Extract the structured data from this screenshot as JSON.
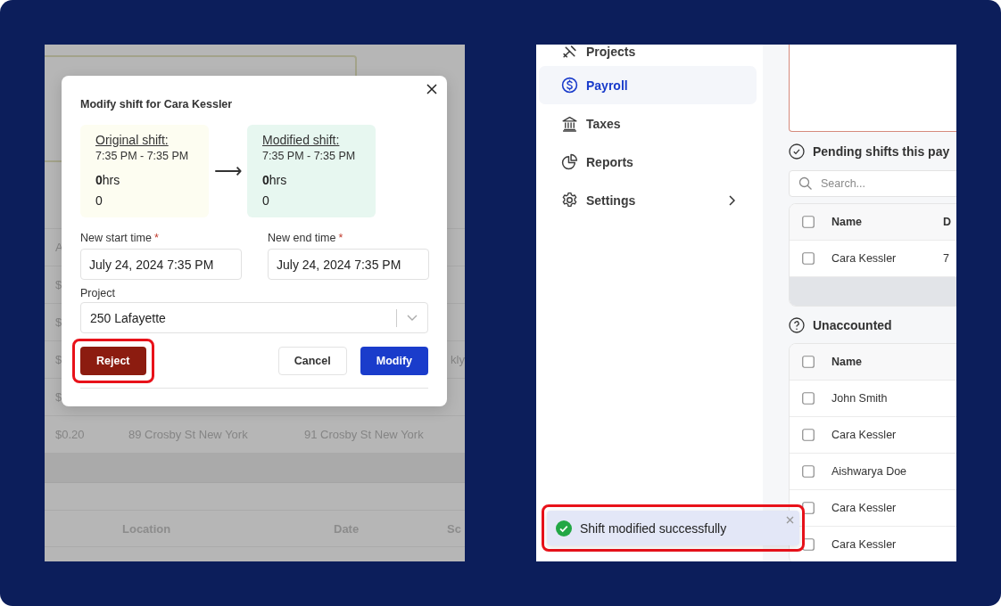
{
  "left_panel": {
    "upper_table": {
      "rows": [
        {
          "column_1": "A"
        },
        {
          "column_1": "$"
        },
        {
          "column_1": "$"
        },
        {
          "column_1": "$",
          "column_4": "kly"
        },
        {
          "column_1": "$"
        },
        {
          "column_1": "$0.20",
          "column_2": "89 Crosby St New York",
          "column_3": "91 Crosby St New York"
        }
      ]
    },
    "lower_table": {
      "header": {
        "column_2": "Location",
        "column_3": "Date",
        "column_4": "Sc"
      }
    },
    "dialog": {
      "title": "Modify shift for Cara Kessler",
      "original": {
        "heading": "Original shift:",
        "time": "7:35 PM - 7:35 PM",
        "hours": "**0**hrs",
        "amount": "0"
      },
      "arrow": "⟶",
      "modified": {
        "heading": "Modified shift:",
        "time": "7:35 PM - 7:35 PM",
        "hours": "**0**hrs",
        "amount": "0"
      },
      "fields": [
        {
          "label": "New start time",
          "required_mark": "*",
          "value": "July 24, 2024 7:35 PM"
        },
        {
          "label": "New end time",
          "required_mark": "*",
          "value": "July 24, 2024 7:35 PM"
        }
      ],
      "project": {
        "label": "Project",
        "value": "250 Lafayette"
      },
      "buttons": [
        {
          "label": "Reject",
          "kind": "danger",
          "highlighted": true
        },
        {
          "label": "Cancel",
          "kind": "secondary",
          "highlighted": false
        },
        {
          "label": "Modify",
          "kind": "primary",
          "highlighted": false
        }
      ]
    }
  },
  "right_panel": {
    "sidebar": {
      "items": [
        {
          "label": "Projects",
          "selected": false,
          "has_submenu": false
        },
        {
          "label": "Payroll",
          "selected": true,
          "has_submenu": false
        },
        {
          "label": "Taxes",
          "selected": false,
          "has_submenu": false
        },
        {
          "label": "Reports",
          "selected": false,
          "has_submenu": false
        },
        {
          "label": "Settings",
          "selected": false,
          "has_submenu": true
        }
      ]
    },
    "pending": {
      "title": "Pending shifts this pay",
      "search": {
        "placeholder": "Search..."
      },
      "table": {
        "header": {
          "checked": false,
          "name": "Name",
          "column_3": "D"
        },
        "rows": [
          {
            "checked": false,
            "name": "Cara Kessler",
            "column_3": "7"
          }
        ]
      }
    },
    "unaccounted": {
      "title": "Unaccounted",
      "table": {
        "header": {
          "checked": false,
          "name": "Name"
        },
        "rows": [
          {
            "checked": false,
            "name": "John Smith"
          },
          {
            "checked": false,
            "name": "Cara Kessler"
          },
          {
            "checked": false,
            "name": "Aishwarya Doe"
          },
          {
            "checked": false,
            "name": "Cara Kessler"
          },
          {
            "checked": false,
            "name": "Cara Kessler"
          }
        ]
      }
    },
    "toast": {
      "message": "Shift modified successfully",
      "highlighted": true
    }
  }
}
